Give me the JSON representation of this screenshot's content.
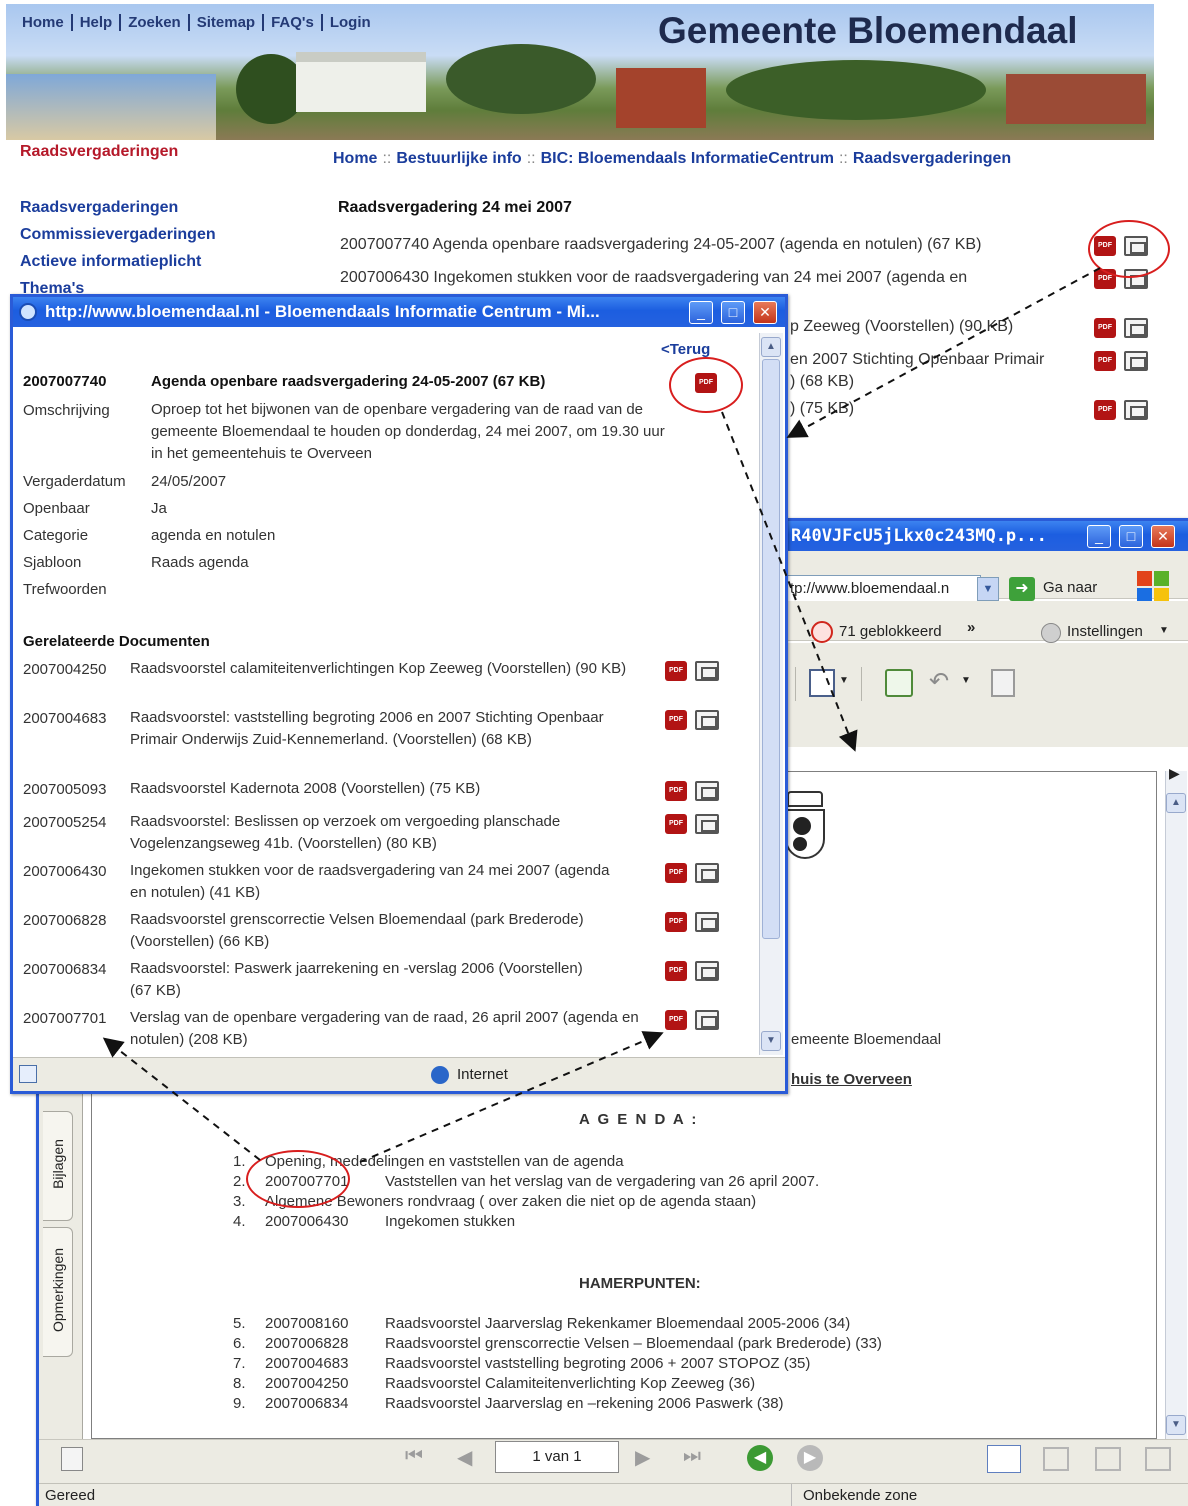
{
  "site": {
    "title": "Gemeente Bloemendaal",
    "topnav": [
      "Home",
      "Help",
      "Zoeken",
      "Sitemap",
      "FAQ's",
      "Login"
    ],
    "section_title": "Raadsvergaderingen",
    "breadcrumb": [
      "Home",
      "Bestuurlijke info",
      "BIC: Bloemendaals InformatieCentrum",
      "Raadsvergaderingen"
    ],
    "breadcrumb_sep": "::",
    "leftnav": [
      "Raadsvergaderingen",
      "Commissievergaderingen",
      "Actieve informatieplicht",
      "Thema's"
    ]
  },
  "meeting": {
    "title": "Raadsvergadering 24 mei 2007",
    "items": [
      "2007007740 Agenda openbare raadsvergadering 24-05-2007 (agenda en notulen) (67 KB)",
      "2007006430 Ingekomen stukken voor de raadsvergadering van 24 mei 2007 (agenda en",
      "p Zeeweg (Voorstellen) (90 KB)",
      "en 2007 Stichting Openbaar Primair",
      ") (68 KB)",
      ") (75 KB)"
    ]
  },
  "popup": {
    "window_title": "http://www.bloemendaal.nl - Bloemendaals Informatie Centrum - Mi...",
    "back_link": "<Terug",
    "doc_number": "2007007740",
    "doc_title": "Agenda openbare raadsvergadering 24-05-2007 (67 KB)",
    "fields": [
      {
        "label": "Omschrijving",
        "value": "Oproep tot het bijwonen van de openbare vergadering van de raad van de gemeente Bloemendaal te houden op donderdag, 24 mei 2007, om 19.30 uur in het gemeentehuis te Overveen"
      },
      {
        "label": "Vergaderdatum",
        "value": "24/05/2007"
      },
      {
        "label": "Openbaar",
        "value": "Ja"
      },
      {
        "label": "Categorie",
        "value": "agenda en notulen"
      },
      {
        "label": "Sjabloon",
        "value": "Raads agenda"
      },
      {
        "label": "Trefwoorden",
        "value": ""
      }
    ],
    "related_heading": "Gerelateerde Documenten",
    "related": [
      {
        "number": "2007004250",
        "text": "Raadsvoorstel calamiteitenverlichtingen Kop Zeeweg (Voorstellen) (90 KB)"
      },
      {
        "number": "2007004683",
        "text": "Raadsvoorstel: vaststelling begroting 2006 en 2007 Stichting Openbaar Primair Onderwijs Zuid-Kennemerland. (Voorstellen) (68 KB)"
      },
      {
        "number": "2007005093",
        "text": "Raadsvoorstel Kadernota 2008 (Voorstellen) (75 KB)"
      },
      {
        "number": "2007005254",
        "text": "Raadsvoorstel: Beslissen op verzoek om vergoeding planschade Vogelenzangseweg 41b. (Voorstellen) (80 KB)"
      },
      {
        "number": "2007006430",
        "text": "Ingekomen stukken voor de raadsvergadering van 24 mei 2007 (agenda en notulen) (41 KB)"
      },
      {
        "number": "2007006828",
        "text": "Raadsvoorstel grenscorrectie Velsen Bloemendaal (park Brederode) (Voorstellen) (66 KB)"
      },
      {
        "number": "2007006834",
        "text": "Raadsvoorstel: Paswerk jaarrekening en -verslag 2006 (Voorstellen) (67 KB)"
      },
      {
        "number": "2007007701",
        "text": "Verslag van de openbare vergadering van de raad, 26 april 2007 (agenda en notulen) (208 KB)"
      }
    ],
    "status_zone": "Internet"
  },
  "pdf_window": {
    "title": "R40VJFcU5jLkx0c243MQ.p...",
    "address": "tp://www.bloemendaal.n",
    "go_label": "Ga naar",
    "blocked_label": "71 geblokkeerd",
    "settings_label": "Instellingen",
    "side_tabs": [
      "Bijlagen",
      "Opmerkingen"
    ],
    "header_fragment": "emeente Bloemendaal",
    "location_fragment": "huis te Overveen",
    "agenda_heading": "A G E N D A :",
    "agenda": [
      {
        "n": "1.",
        "num": "",
        "text": "Opening, mededelingen en vaststellen van de agenda"
      },
      {
        "n": "2.",
        "num": "2007007701",
        "text": "Vaststellen van het verslag van de vergadering van 26 april 2007."
      },
      {
        "n": "3.",
        "num": "",
        "text": "Algemene Bewoners rondvraag ( over zaken die niet op de agenda staan)"
      },
      {
        "n": "4.",
        "num": "2007006430",
        "text": "Ingekomen stukken"
      }
    ],
    "hamer_heading": "HAMERPUNTEN:",
    "hamer": [
      {
        "n": "5.",
        "num": "2007008160",
        "text": "Raadsvoorstel Jaarverslag Rekenkamer Bloemendaal 2005-2006 (34)"
      },
      {
        "n": "6.",
        "num": "2007006828",
        "text": "Raadsvoorstel grenscorrectie Velsen – Bloemendaal (park Brederode) (33)"
      },
      {
        "n": "7.",
        "num": "2007004683",
        "text": "Raadsvoorstel vaststelling begroting 2006 + 2007  STOPOZ (35)"
      },
      {
        "n": "8.",
        "num": "2007004250",
        "text": "Raadsvoorstel Calamiteitenverlichting Kop Zeeweg (36)"
      },
      {
        "n": "9.",
        "num": "2007006834",
        "text": "Raadsvoorstel Jaarverslag en –rekening 2006 Paswerk (38)"
      }
    ],
    "page_indicator": "1 van 1",
    "status_left": "Gereed",
    "status_right": "Onbekende zone"
  },
  "icons": {
    "pdf": "pdf-icon",
    "details": "document-details-icon",
    "pdf_label": "PDF"
  },
  "colors": {
    "link": "#1b3d9c",
    "section": "#b5192a",
    "annotation": "#d81e1e",
    "xp_blue": "#2a5bd7"
  }
}
